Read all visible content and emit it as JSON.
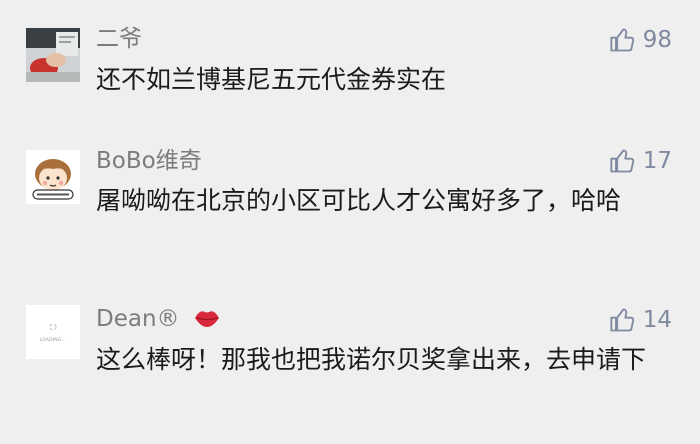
{
  "comments": [
    {
      "author": "二爷",
      "likes": "98",
      "text": "还不如兰博基尼五元代金券实在",
      "avatar_icon": "photo-avatar-icon"
    },
    {
      "author": "BoBo维奇",
      "likes": "17",
      "text": "屠呦呦在北京的小区可比人才公寓好多了，哈哈",
      "avatar_icon": "cartoon-boy-avatar-icon"
    },
    {
      "author": "Dean®",
      "likes": "14",
      "text": "这么棒呀！那我也把我诺尔贝奖拿出来，去申请下",
      "avatar_icon": "loading-avatar-icon",
      "avatar_text": "LOADING..."
    }
  ],
  "icons": {
    "like": "thumbs-up-icon",
    "name_emoji": "kiss-lips-icon"
  },
  "colors": {
    "background": "#efefef",
    "name": "#7c7c7c",
    "like": "#7f8aa0",
    "text": "#1b1b1b",
    "lips": "#d8283c"
  }
}
